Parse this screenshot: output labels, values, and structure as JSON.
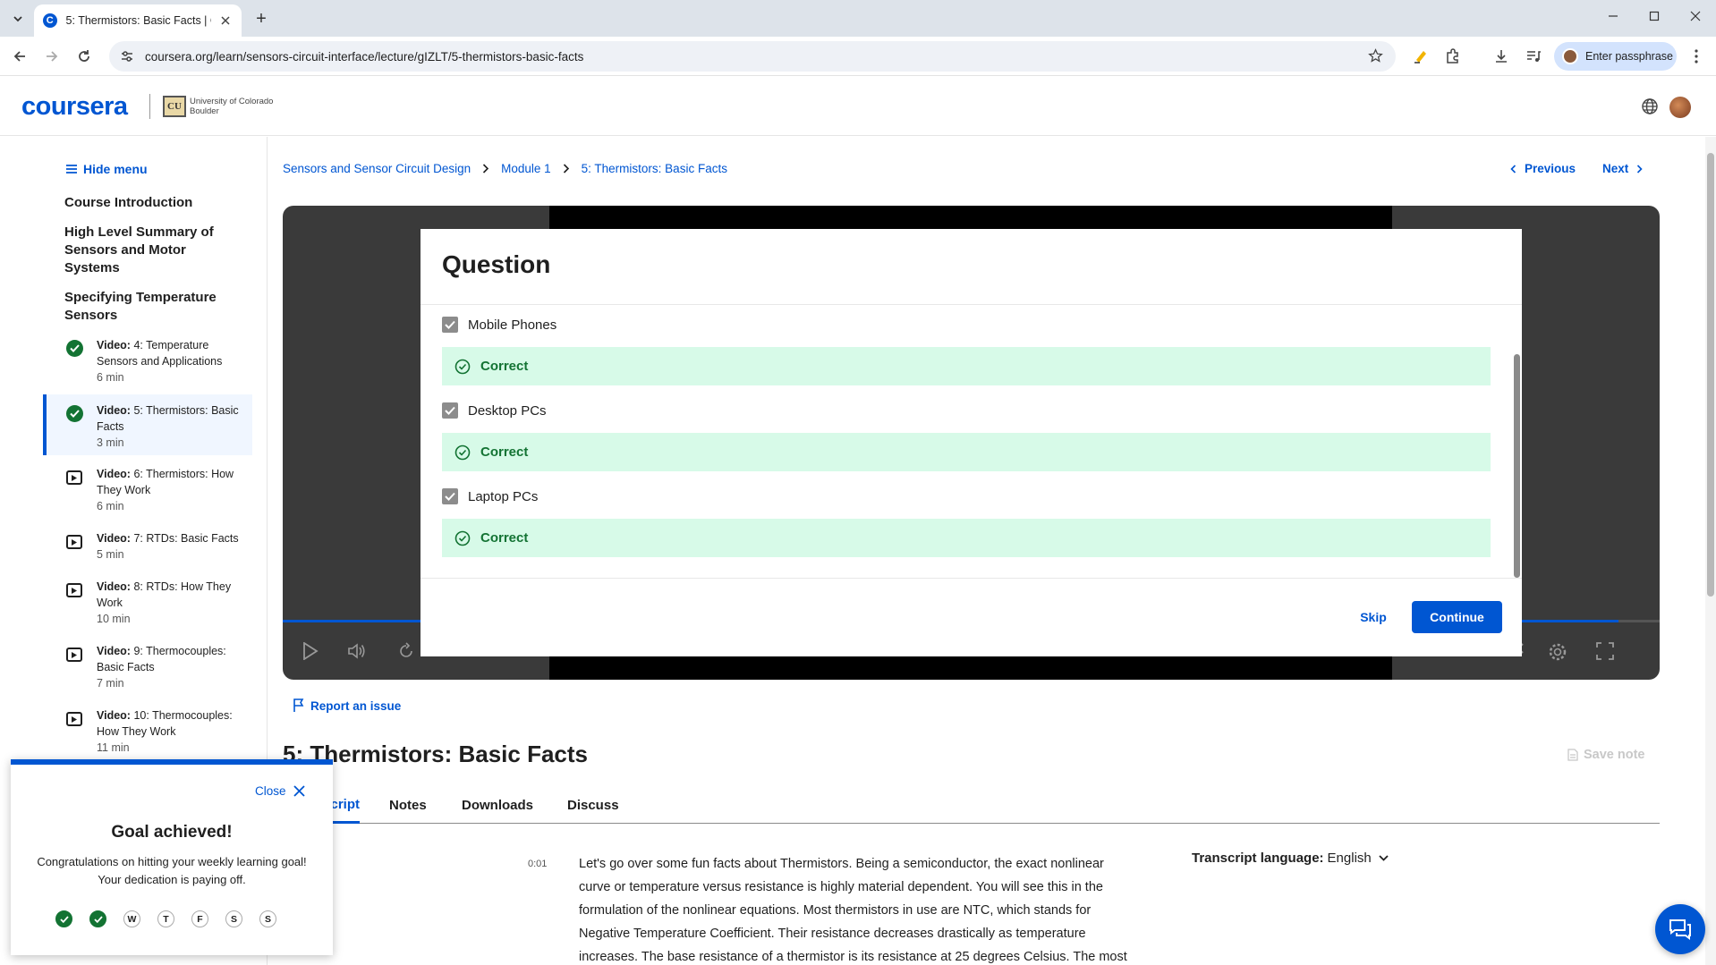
{
  "browser": {
    "tab_title": "5: Thermistors: Basic Facts | Coursera",
    "url": "coursera.org/learn/sensors-circuit-interface/lecture/gIZLT/5-thermistors-basic-facts",
    "profile_label": "Enter passphrase"
  },
  "header": {
    "logo": "coursera",
    "partner_name_line1": "University of Colorado",
    "partner_name_line2": "Boulder",
    "partner_mark": "CU"
  },
  "sidebar": {
    "hide_menu": "Hide menu",
    "sections": [
      "Course Introduction",
      "High Level Summary of Sensors and Motor Systems",
      "Specifying Temperature Sensors"
    ],
    "items": [
      {
        "type": "Video:",
        "title": "4: Temperature Sensors and Applications",
        "duration": "6 min",
        "status": "completed"
      },
      {
        "type": "Video:",
        "title": "5: Thermistors: Basic Facts",
        "duration": "3 min",
        "status": "completed"
      },
      {
        "type": "Video:",
        "title": "6: Thermistors: How They Work",
        "duration": "6 min",
        "status": "not-started"
      },
      {
        "type": "Video:",
        "title": "7: RTDs: Basic Facts",
        "duration": "5 min",
        "status": "not-started"
      },
      {
        "type": "Video:",
        "title": "8: RTDs: How They Work",
        "duration": "10 min",
        "status": "not-started"
      },
      {
        "type": "Video:",
        "title": "9: Thermocouples: Basic Facts",
        "duration": "7 min",
        "status": "not-started"
      },
      {
        "type": "Video:",
        "title": "10: Thermocouples: How They Work",
        "duration": "11 min",
        "status": "not-started"
      }
    ]
  },
  "breadcrumb": [
    "Sensors and Sensor Circuit Design",
    "Module 1",
    "5: Thermistors: Basic Facts"
  ],
  "nav": {
    "previous": "Previous",
    "next": "Next"
  },
  "player": {
    "progress_fraction": 0.97
  },
  "question": {
    "title": "Question",
    "options": [
      {
        "label": "Mobile Phones",
        "checked": true,
        "feedback": "Correct"
      },
      {
        "label": "Desktop PCs",
        "checked": true,
        "feedback": "Correct"
      },
      {
        "label": "Laptop PCs",
        "checked": true,
        "feedback": "Correct"
      }
    ],
    "skip": "Skip",
    "continue": "Continue"
  },
  "report_issue": "Report an issue",
  "lecture_title": "5: Thermistors: Basic Facts",
  "save_note": "Save note",
  "tabs": [
    "Transcript",
    "Notes",
    "Downloads",
    "Discuss"
  ],
  "transcript": {
    "timestamp": "0:01",
    "text": "Let's go over some fun facts about Thermistors. Being a semiconductor, the exact nonlinear curve or temperature versus resistance is highly material dependent. You will see this in the formulation of the nonlinear equations. Most thermistors in use are NTC, which stands for Negative Temperature Coefficient. Their resistance decreases drastically as temperature increases. The base resistance of a thermistor is its resistance at 25 degrees Celsius. The most",
    "language_label": "Transcript language:",
    "language": "English"
  },
  "goal": {
    "close": "Close",
    "title": "Goal achieved!",
    "message": "Congratulations on hitting your weekly learning goal! Your dedication is paying off.",
    "days": [
      {
        "label": "",
        "done": true
      },
      {
        "label": "",
        "done": true
      },
      {
        "label": "W",
        "done": false
      },
      {
        "label": "T",
        "done": false
      },
      {
        "label": "F",
        "done": false
      },
      {
        "label": "S",
        "done": false
      },
      {
        "label": "S",
        "done": false
      }
    ]
  },
  "colors": {
    "brand": "#0056d2",
    "success": "#137333",
    "success_bg": "#d7fae8"
  }
}
